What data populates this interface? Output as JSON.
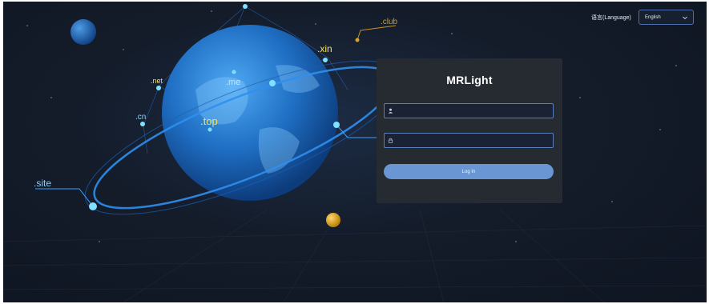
{
  "page": {
    "background": "#141c2a",
    "accent": "#6a97d4"
  },
  "language": {
    "label": "语言(Language)",
    "selected": "English",
    "icon": "chevron-down-icon"
  },
  "login": {
    "title": "MRLight",
    "username_placeholder": "",
    "username_icon": "user-icon",
    "password_placeholder": "",
    "password_icon": "lock-icon",
    "button_label": "Log In"
  },
  "background_art": {
    "domains": [
      ".club",
      ".xin",
      ".net",
      ".me",
      ".cn",
      ".top",
      ".site"
    ]
  }
}
